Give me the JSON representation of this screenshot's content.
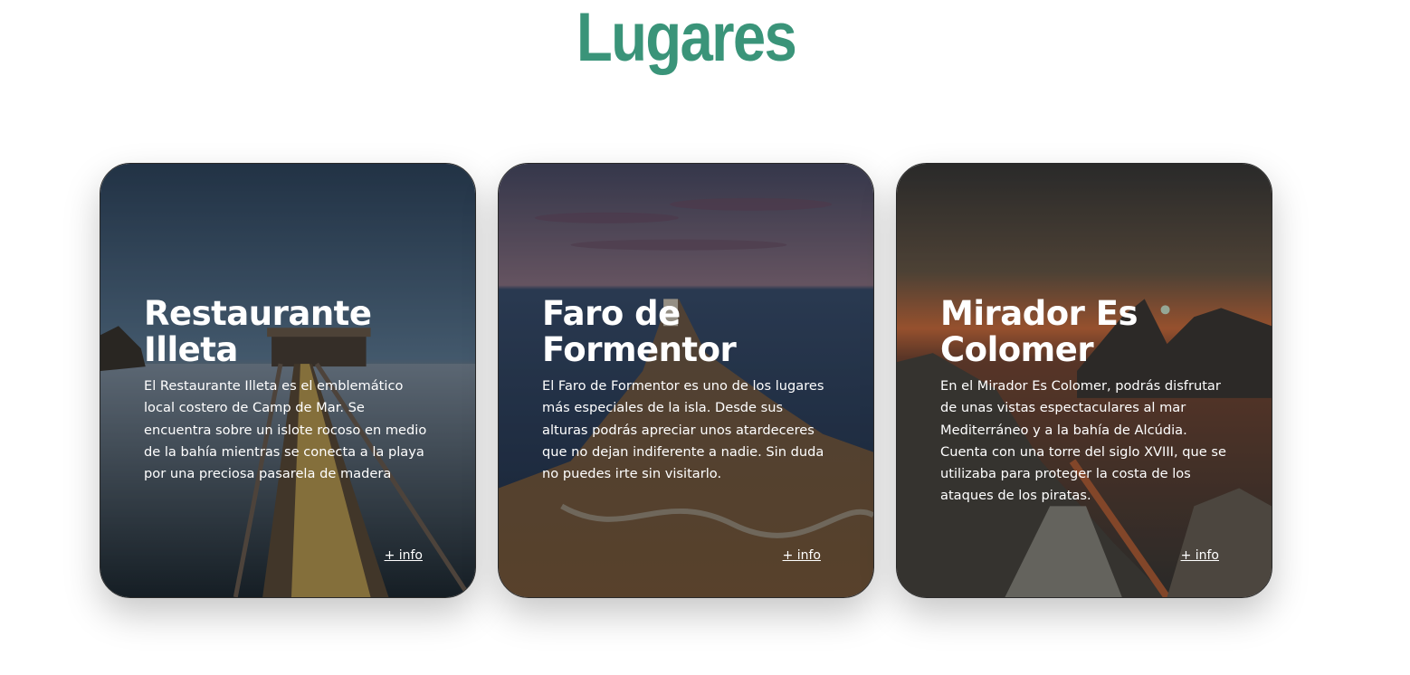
{
  "page": {
    "title": "Lugares",
    "accent_color": "#3a9479"
  },
  "cards": [
    {
      "title": "Restaurante Illeta",
      "text": "El Restaurante Illeta es el emblemático local costero de Camp de Mar. Se encuentra sobre un islote rocoso en medio de la bahía mientras se conecta a la playa por una preciosa pasarela de madera",
      "link": "+ info"
    },
    {
      "title": "Faro de Formentor",
      "text": "El Faro de Formentor es uno de los lugares más especiales de la isla. Desde sus alturas podrás apreciar unos atardeceres que no dejan indiferente a nadie. Sin duda no puedes irte sin visitarlo.",
      "link": "+ info"
    },
    {
      "title": "Mirador Es Colomer",
      "text": "En el Mirador Es Colomer, podrás disfrutar de unas vistas espectaculares al mar Mediterráneo y a la bahía de Alcúdia. Cuenta con una torre del siglo XVIII, que se utilizaba para proteger la costa de los ataques de los piratas.",
      "link": "+ info"
    }
  ]
}
